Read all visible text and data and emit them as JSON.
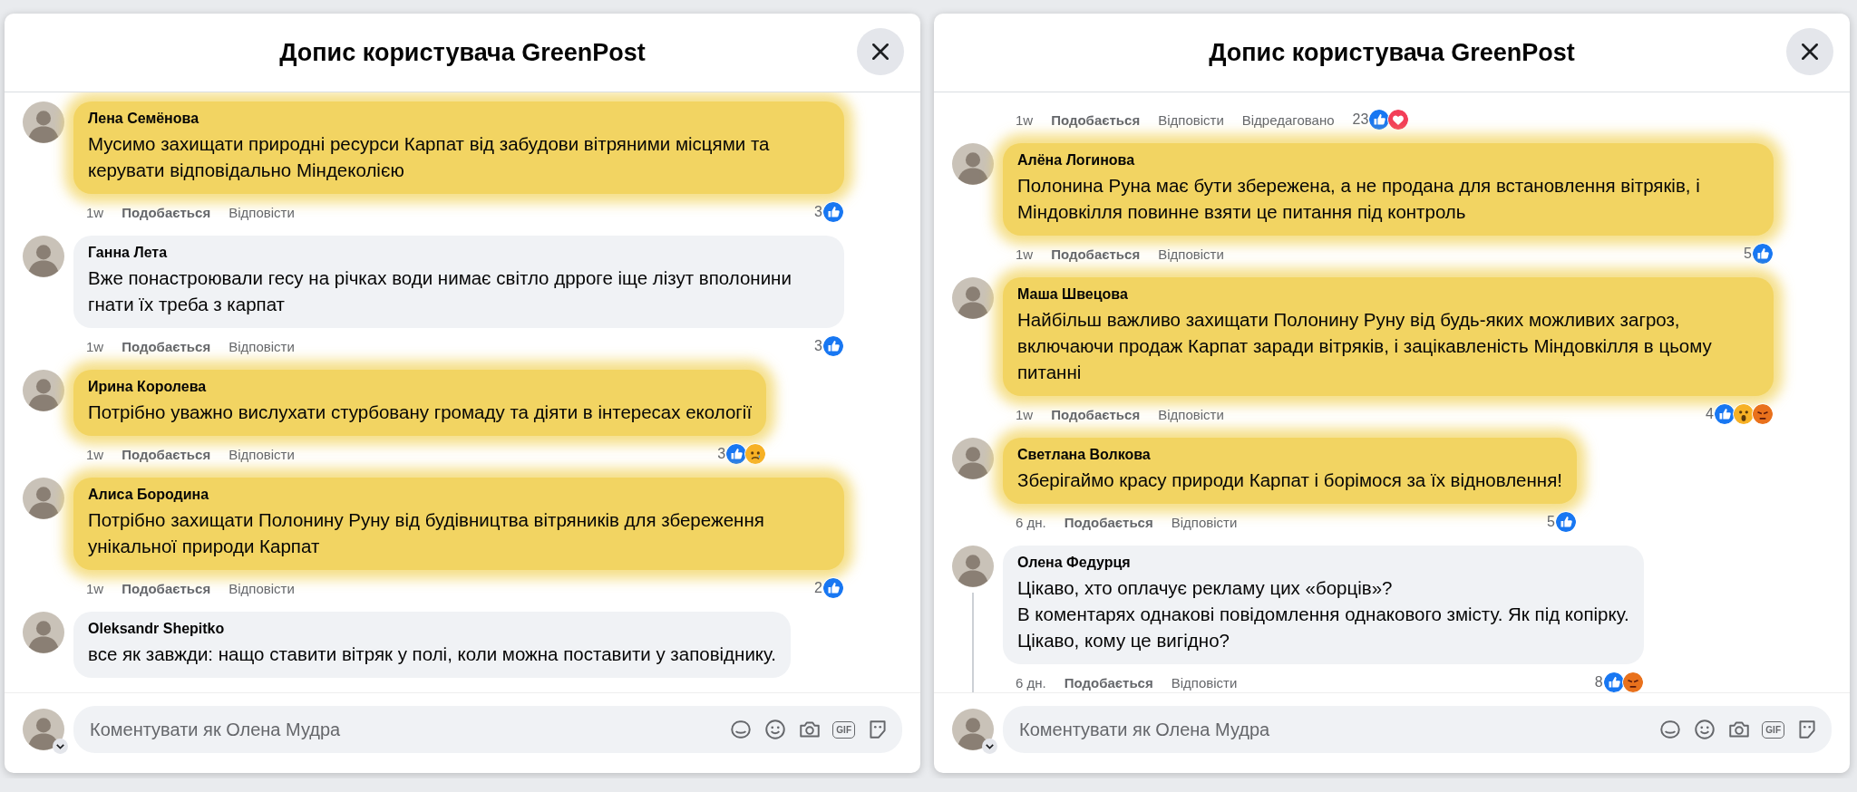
{
  "panels": [
    {
      "title": "Допис користувача GreenPost",
      "comments": [
        {
          "author": "Лена Семёнова",
          "text": "Мусимо захищати природні ресурси Карпат від забудови вітряними місцями та керувати відповідально Міндеколією",
          "highlighted": true,
          "time": "1w",
          "like": "Подобається",
          "reply": "Відповісти",
          "count": "3",
          "reactions": [
            {
              "kind": "like"
            }
          ]
        },
        {
          "author": "Ганна Лета",
          "text": "Вже понастроювали гесу на річках води нимає світло дрроге іще лізут вполонини гнати їх треба з карпат",
          "highlighted": false,
          "time": "1w",
          "like": "Подобається",
          "reply": "Відповісти",
          "count": "3",
          "reactions": [
            {
              "kind": "like"
            }
          ]
        },
        {
          "author": "Ирина Королева",
          "text": "Потрібно уважно вислухати стурбовану громаду та діяти в інтересах екології",
          "highlighted": true,
          "time": "1w",
          "like": "Подобається",
          "reply": "Відповісти",
          "count": "3",
          "reactions": [
            {
              "kind": "like"
            },
            {
              "kind": "sad"
            }
          ]
        },
        {
          "author": "Алиса Бородина",
          "text": "Потрібно захищати Полонину Руну від будівництва вітряників для збереження унікальної природи Карпат",
          "highlighted": true,
          "time": "1w",
          "like": "Подобається",
          "reply": "Відповісти",
          "count": "2",
          "reactions": [
            {
              "kind": "like"
            }
          ]
        },
        {
          "author": "Oleksandr Shepitko",
          "text": "все як завжди: нащо ставити вітряк у полі, коли можна поставити у заповіднику.",
          "highlighted": false
        }
      ],
      "composer": {
        "placeholder": "Коментувати як Олена Мудра",
        "gif": "GIF"
      }
    },
    {
      "title": "Допис користувача GreenPost",
      "comments": [
        {
          "time": "1w",
          "like": "Подобається",
          "reply": "Відповісти",
          "edited": "Відредаговано",
          "count": "23",
          "reactions": [
            {
              "kind": "like"
            },
            {
              "kind": "love"
            }
          ]
        },
        {
          "author": "Алёна Логинова",
          "text": "Полонина Руна має бути збережена, а не продана для встановлення вітряків, і Міндовкілля повинне взяти це питання під контроль",
          "highlighted": true,
          "time": "1w",
          "like": "Подобається",
          "reply": "Відповісти",
          "count": "5",
          "reactions": [
            {
              "kind": "like"
            }
          ]
        },
        {
          "author": "Маша Швецова",
          "text": "Найбільш важливо захищати Полонину Руну від будь-яких можливих загроз, включаючи продаж Карпат заради вітряків, і зацікавленість Міндовкілля в цьому питанні",
          "highlighted": true,
          "time": "1w",
          "like": "Подобається",
          "reply": "Відповісти",
          "count": "4",
          "reactions": [
            {
              "kind": "like"
            },
            {
              "kind": "wow"
            },
            {
              "kind": "angry"
            }
          ]
        },
        {
          "author": "Светлана Волкова",
          "text": "Зберігаймо красу природи Карпат і борімося за їх відновлення!",
          "highlighted": true,
          "time": "6 дн.",
          "like": "Подобається",
          "reply": "Відповісти",
          "count": "5",
          "reactions": [
            {
              "kind": "like"
            }
          ]
        },
        {
          "author": "Олена Федурця",
          "text": "Цікаво, хто оплачує рекламу цих «борців»?\nВ коментарях однакові повідомлення однакового змісту. Як під копірку.\nЦікаво, кому це вигідно?",
          "highlighted": false,
          "has_replies": true,
          "time": "6 дн.",
          "like": "Подобається",
          "reply": "Відповісти",
          "count": "8",
          "reactions": [
            {
              "kind": "like"
            },
            {
              "kind": "angry"
            }
          ]
        }
      ],
      "composer": {
        "placeholder": "Коментувати як Олена Мудра",
        "gif": "GIF"
      }
    }
  ]
}
